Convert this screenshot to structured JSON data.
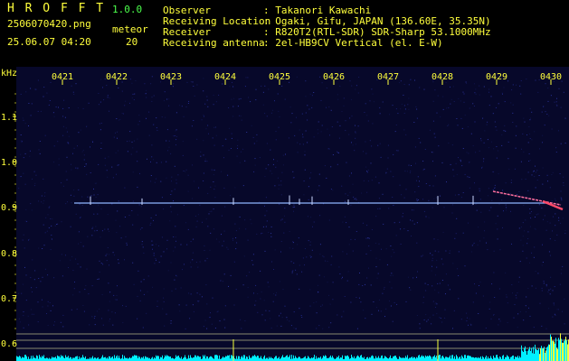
{
  "app": {
    "name": "H R O F F T",
    "version": "1.0.0",
    "filename": "2506070420.png",
    "datetime": "25.06.07 04:20",
    "meteor_label": "meteor",
    "meteor_count": "20"
  },
  "info": {
    "observer_label": "Observer",
    "observer_value": ": Takanori Kawachi",
    "location_label": "Receiving Location",
    "location_value": ": Ogaki, Gifu, JAPAN (136.60E, 35.35N)",
    "receiver_label": "Receiver",
    "receiver_value": ": R820T2(RTL-SDR) SDR-Sharp 53.1000MHz",
    "antenna_label": "Receiving antenna",
    "antenna_value": ": 2el-HB9CV Vertical (el. E-W)"
  },
  "axis": {
    "unit": "kHz",
    "time_ticks": [
      "0421",
      "0422",
      "0423",
      "0424",
      "0425",
      "0426",
      "0427",
      "0428",
      "0429",
      "0430"
    ],
    "freq_ticks": [
      "1.1",
      "1.0",
      "0.9",
      "0.8",
      "0.7",
      "0.6"
    ]
  },
  "colors": {
    "label": "#ffff3c",
    "header_info": "#4cff4c",
    "background": "#07082a",
    "carrier": "#8fb4ff",
    "spectrum": "#00f0ff"
  }
}
